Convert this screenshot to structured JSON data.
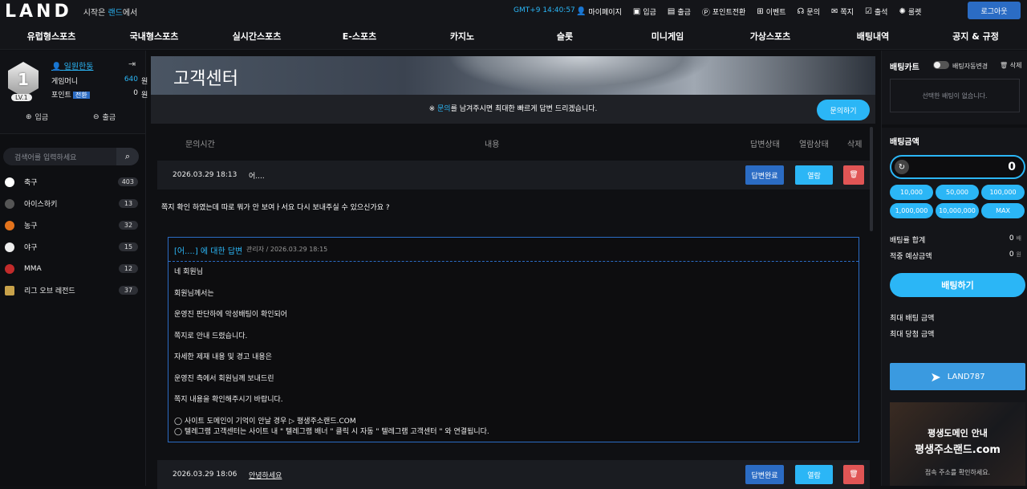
{
  "header": {
    "logo": "LAND",
    "tagline_pre": "시작은 ",
    "tagline_hl": "랜드",
    "tagline_post": "에서",
    "clock": "GMT+9 14:40:57",
    "menu": [
      "마이페이지",
      "입금",
      "출금",
      "포인트전환",
      "이벤트",
      "문의",
      "쪽지",
      "출석",
      "룰렛"
    ],
    "logout": "로그아웃"
  },
  "nav": [
    "유럽형스포츠",
    "국내형스포츠",
    "실시간스포츠",
    "E-스포츠",
    "카지노",
    "슬롯",
    "미니게임",
    "가상스포츠",
    "배팅내역",
    "공지 & 규정"
  ],
  "profile": {
    "level_num": "1",
    "level": "LV.1",
    "name": "일원한동",
    "money_label": "게임머니",
    "money": "640",
    "money_unit": "원",
    "point_label": "포인트",
    "point_badge": "전환",
    "point": "0",
    "point_unit": "원",
    "deposit": "입금",
    "withdraw": "출금"
  },
  "search": {
    "placeholder": "검색어를 입력하세요"
  },
  "sports": [
    {
      "name": "축구",
      "count": "403",
      "color": "#ffffff"
    },
    {
      "name": "아이스하키",
      "count": "13",
      "color": "#555555"
    },
    {
      "name": "농구",
      "count": "32",
      "color": "#e3731c"
    },
    {
      "name": "야구",
      "count": "15",
      "color": "#eeeeee"
    },
    {
      "name": "MMA",
      "count": "12",
      "color": "#c22b2b"
    },
    {
      "name": "리그 오브 레전드",
      "count": "37",
      "color": "#c8a24a"
    }
  ],
  "page": {
    "title": "고객센터",
    "notice_pre": "※ ",
    "notice_hl": "문의",
    "notice_post": "를 남겨주시면 최대한 빠르게 답변 드리겠습니다.",
    "ask_button": "문의하기",
    "columns": [
      "문의시간",
      "내용",
      "답변상태",
      "열람상태",
      "삭제"
    ]
  },
  "inquiries": [
    {
      "date": "2026.03.29 18:13",
      "subject": "어....",
      "status": "답변완료",
      "view": "열람"
    },
    {
      "date": "2026.03.29 18:06",
      "subject": "안녕하세요",
      "status": "답변완료",
      "view": "열람"
    }
  ],
  "question": "쪽지 확인 하였는데 따로 뭐가 안 보여ㅏ서요 다시 보내주실 수 있으신가요 ?",
  "reply": {
    "title": "[어....] 에 대한 답변",
    "meta": "관리자 / 2026.03.29 18:15",
    "lines": [
      "네 회원님",
      "회원님께서는",
      "운영진 판단하에 악성배팅이 확인되어",
      "쪽지로 안내 드렸습니다.",
      "자세한 제재 내용 및 경고 내용은",
      "운영진 측에서 회원님께 보내드린",
      "쪽지 내용을 확인해주시기 바랍니다.",
      "◯ 사이트 도메인이 기억이 안날 경우 ▷ 평생주소랜드.COM",
      "◯ 텔레그램 고객센터는 사이트 내 \" 텔레그램 배너 \" 클릭 시 자동 \" 텔레그램 고객센터 \" 와 연결됩니다."
    ]
  },
  "betslip": {
    "title": "배팅카트",
    "toggle_label": "배팅자동변경",
    "delete": "삭제",
    "empty": "선택한 배팅이 없습니다.",
    "amount_title": "배팅금액",
    "amount": "0",
    "chips": [
      "10,000",
      "50,000",
      "100,000",
      "1,000,000",
      "10,000,000",
      "MAX"
    ],
    "odds_label": "배팅률 합계",
    "odds": "0",
    "odds_unit": "배",
    "expected_label": "적중 예상금액",
    "expected": "0",
    "expected_unit": "원",
    "bet_button": "배팅하기",
    "max_bet": "최대 배팅 금액",
    "max_win": "최대 당첨 금액",
    "telegram": "LAND787"
  },
  "promo": {
    "line1": "평생도메인 안내",
    "line2": "평생주소랜드.com",
    "line3": "접속 주소를 확인하세요."
  }
}
